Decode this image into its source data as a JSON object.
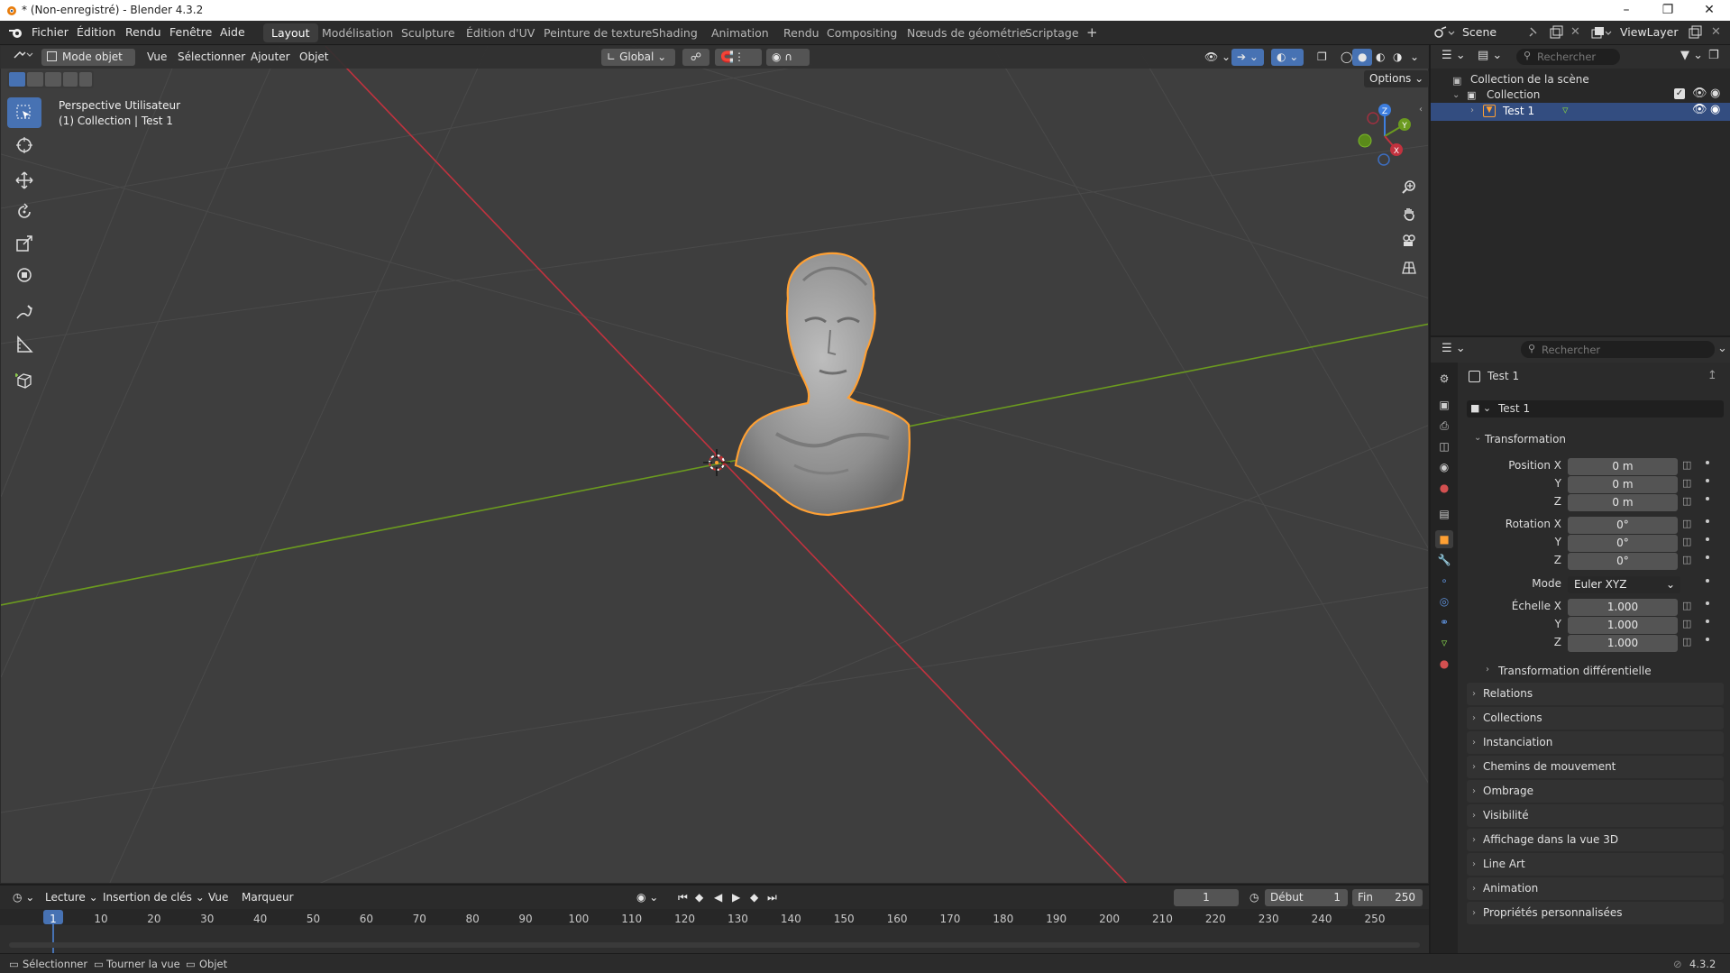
{
  "window": {
    "title": "* (Non-enregistré) - Blender 4.3.2"
  },
  "menus": [
    "Fichier",
    "Édition",
    "Rendu",
    "Fenêtre",
    "Aide"
  ],
  "workspaces": [
    "Layout",
    "Modélisation",
    "Sculpture",
    "Édition d'UV",
    "Peinture de texture",
    "Shading",
    "Animation",
    "Rendu",
    "Compositing",
    "Nœuds de géométrie",
    "Scriptage"
  ],
  "active_workspace": "Layout",
  "scene": {
    "name": "Scene",
    "view_layer": "ViewLayer"
  },
  "viewport": {
    "mode": "Mode objet",
    "menus": [
      "Vue",
      "Sélectionner",
      "Ajouter",
      "Objet"
    ],
    "orientation": "Global",
    "options_label": "Options",
    "overlay_line1": "Perspective Utilisateur",
    "overlay_line2": "(1) Collection | Test 1",
    "gizmo": {
      "z": "Z",
      "y": "Y",
      "x": "X"
    }
  },
  "outliner": {
    "search_placeholder": "Rechercher",
    "scene_collection": "Collection de la scène",
    "collection": "Collection",
    "object": "Test 1"
  },
  "properties": {
    "search_placeholder": "Rechercher",
    "object_name": "Test 1",
    "data_name": "Test 1",
    "transform_header": "Transformation",
    "position_label": "Position X",
    "rotation_label": "Rotation X",
    "scale_label": "Échelle X",
    "y_label": "Y",
    "z_label": "Z",
    "mode_label": "Mode",
    "mode_value": "Euler XYZ",
    "position": [
      "0 m",
      "0 m",
      "0 m"
    ],
    "rotation": [
      "0°",
      "0°",
      "0°"
    ],
    "scale": [
      "1.000",
      "1.000",
      "1.000"
    ],
    "delta_transform": "Transformation différentielle",
    "panels": [
      "Relations",
      "Collections",
      "Instanciation",
      "Chemins de mouvement",
      "Ombrage",
      "Visibilité",
      "Affichage dans la vue 3D",
      "Line Art",
      "Animation",
      "Propriétés personnalisées"
    ]
  },
  "timeline": {
    "menus": [
      "Lecture",
      "Insertion de clés",
      "Vue",
      "Marqueur"
    ],
    "current_frame": "1",
    "start_label": "Début",
    "start_value": "1",
    "end_label": "Fin",
    "end_value": "250",
    "ticks": [
      "1",
      "10",
      "20",
      "30",
      "40",
      "50",
      "60",
      "70",
      "80",
      "90",
      "100",
      "110",
      "120",
      "130",
      "140",
      "150",
      "160",
      "170",
      "180",
      "190",
      "200",
      "210",
      "220",
      "230",
      "240",
      "250"
    ]
  },
  "statusbar": {
    "select": "Sélectionner",
    "rotate": "Tourner la vue",
    "object": "Objet",
    "version": "4.3.2"
  },
  "colors": {
    "accent": "#4772b3",
    "selection": "#ffa033",
    "x_axis": "#c2323e",
    "y_axis": "#6b9a1f",
    "z_axis": "#3d7ee0"
  }
}
